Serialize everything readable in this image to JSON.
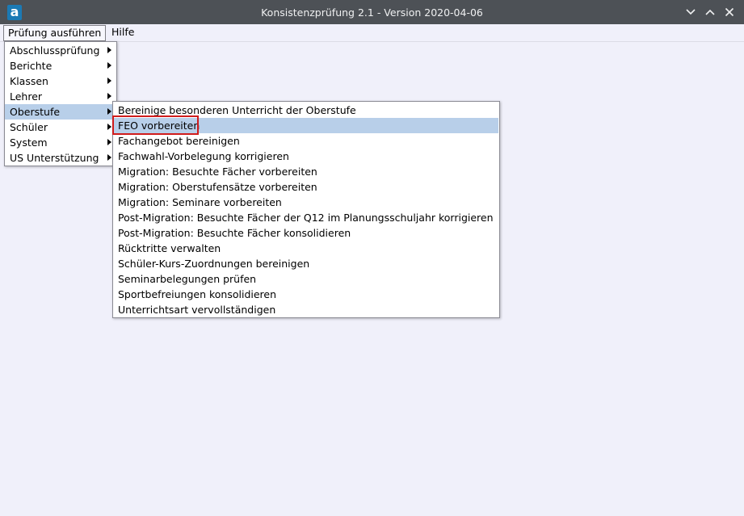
{
  "window": {
    "title": "Konsistenzprüfung 2.1 - Version 2020-04-06",
    "logo_letter": "a",
    "icons": {
      "app": "app-logo-icon",
      "minimize": "minimize-icon",
      "maximize": "maximize-icon",
      "close": "close-icon"
    }
  },
  "menubar": {
    "items": [
      {
        "label": "Prüfung ausführen",
        "active": true
      },
      {
        "label": "Hilfe",
        "active": false
      }
    ]
  },
  "main_menu": {
    "items": [
      {
        "label": "Abschlussprüfung",
        "has_submenu": true
      },
      {
        "label": "Berichte",
        "has_submenu": true
      },
      {
        "label": "Klassen",
        "has_submenu": true
      },
      {
        "label": "Lehrer",
        "has_submenu": true
      },
      {
        "label": "Oberstufe",
        "has_submenu": true,
        "highlighted": true
      },
      {
        "label": "Schüler",
        "has_submenu": true
      },
      {
        "label": "System",
        "has_submenu": true
      },
      {
        "label": "US Unterstützung",
        "has_submenu": true
      }
    ]
  },
  "submenu": {
    "items": [
      {
        "label": "Bereinige besonderen Unterricht der Oberstufe"
      },
      {
        "label": "FEO vorbereiten",
        "highlighted": true
      },
      {
        "label": "Fachangebot bereinigen"
      },
      {
        "label": "Fachwahl-Vorbelegung korrigieren"
      },
      {
        "label": "Migration: Besuchte Fächer vorbereiten"
      },
      {
        "label": "Migration: Oberstufensätze vorbereiten"
      },
      {
        "label": "Migration: Seminare vorbereiten"
      },
      {
        "label": "Post-Migration: Besuchte Fächer der Q12 im Planungsschuljahr korrigieren"
      },
      {
        "label": "Post-Migration: Besuchte Fächer konsolidieren"
      },
      {
        "label": "Rücktritte verwalten"
      },
      {
        "label": "Schüler-Kurs-Zuordnungen bereinigen"
      },
      {
        "label": "Seminarbelegungen prüfen"
      },
      {
        "label": "Sportbefreiungen konsolidieren"
      },
      {
        "label": "Unterrichtsart vervollständigen"
      }
    ]
  },
  "colors": {
    "titlebar": "#4d5156",
    "background": "#f0f0fa",
    "highlight": "#b8cfe9",
    "focus_outline": "#d01c1c",
    "logo": "#1b7ab5"
  }
}
